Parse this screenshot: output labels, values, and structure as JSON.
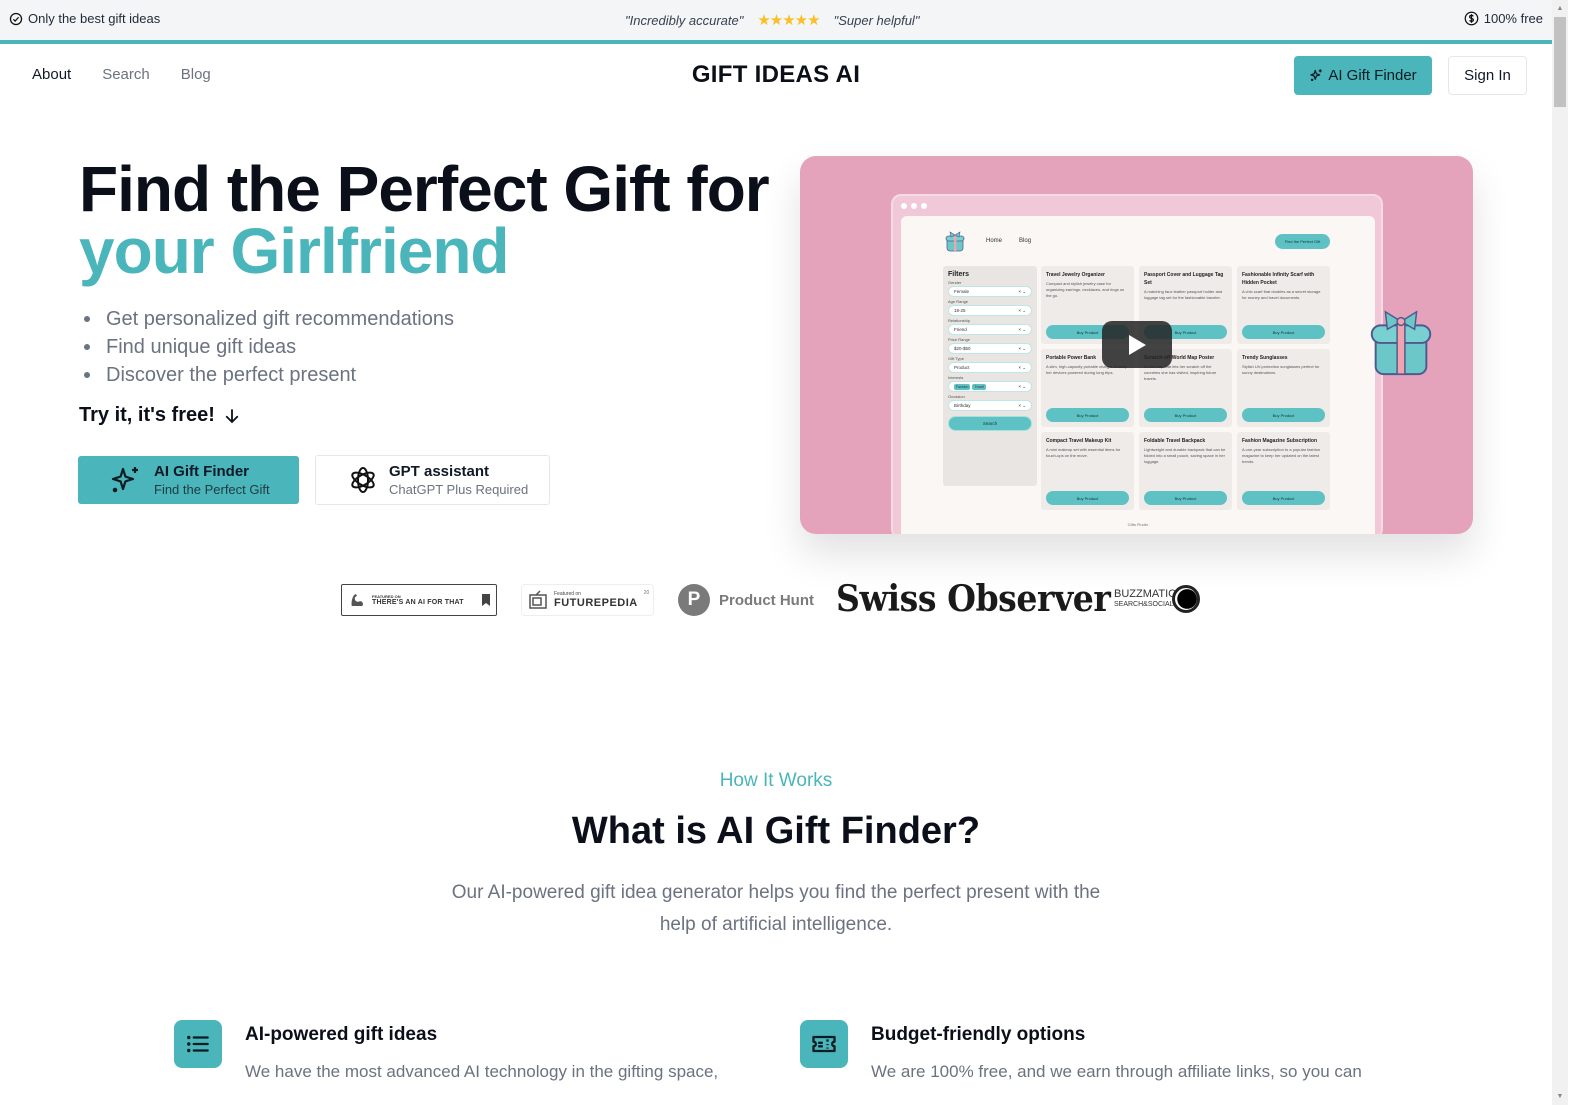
{
  "topbar": {
    "left_text": "Only the best gift ideas",
    "left_icon": "check-circle-icon",
    "quote_1": "\"Incredibly accurate\"",
    "rating_stars": 5,
    "stars_glyph": "★★★★★",
    "quote_2": "\"Super helpful\"",
    "right_text": "100% free",
    "right_icon": "dollar-circle-icon"
  },
  "header": {
    "nav": [
      {
        "label": "About",
        "active": true
      },
      {
        "label": "Search",
        "active": false
      },
      {
        "label": "Blog",
        "active": false
      }
    ],
    "brand": "GIFT IDEAS AI",
    "cta_label": "AI Gift Finder",
    "signin_label": "Sign In"
  },
  "hero": {
    "title_line1": "Find the Perfect Gift for",
    "title_line2": "your Girlfriend",
    "bullets": [
      "Get personalized gift recommendations",
      "Find unique gift ideas",
      "Discover the perfect present"
    ],
    "try_free": "Try it, it's free!",
    "cta_primary": {
      "title": "AI Gift Finder",
      "subtitle": "Find the Perfect Gift"
    },
    "cta_secondary": {
      "title": "GPT assistant",
      "subtitle": "ChatGPT Plus Required"
    }
  },
  "video_preview": {
    "nav": [
      "Home",
      "Blog"
    ],
    "top_button": "Find the Perfect Gift",
    "filters_title": "Filters",
    "filters": [
      {
        "label": "Gender",
        "value": "Female"
      },
      {
        "label": "Age Range",
        "value": "18-25"
      },
      {
        "label": "Relationship",
        "value": "Friend"
      },
      {
        "label": "Price Range",
        "value": "$20-$50"
      },
      {
        "label": "Gift Type",
        "value": "Product"
      },
      {
        "label": "Interests",
        "chips": [
          "Fashion",
          "Travel"
        ]
      },
      {
        "label": "Occasion",
        "value": "Birthday"
      }
    ],
    "search_button": "Search",
    "cards": [
      {
        "title": "Travel Jewelry Organizer",
        "desc": "Compact and stylish jewelry case for organizing earrings, necklaces, and rings on the go.",
        "button": "Buy Product"
      },
      {
        "title": "Passport Cover and Luggage Tag Set",
        "desc": "A matching faux leather passport holder and luggage tag set for the fashionable traveler.",
        "button": "Buy Product"
      },
      {
        "title": "Fashionable Infinity Scarf with Hidden Pocket",
        "desc": "A chic scarf that doubles as a secret storage for money and travel documents.",
        "button": "Buy Product"
      },
      {
        "title": "Portable Power Bank",
        "desc": "A slim, high-capacity portable charger to keep her devices powered during long trips.",
        "button": "Buy Product"
      },
      {
        "title": "Scratch-off World Map Poster",
        "desc": "A wall map that lets her scratch off the countries she has visited, inspiring future travels.",
        "button": "Buy Product"
      },
      {
        "title": "Trendy Sunglasses",
        "desc": "Stylish UV-protection sunglasses perfect for sunny destinations.",
        "button": "Buy Product"
      },
      {
        "title": "Compact Travel Makeup Kit",
        "desc": "A mini makeup set with essential items for touch-ups on the move.",
        "button": "Buy Product"
      },
      {
        "title": "Foldable Travel Backpack",
        "desc": "Lightweight and durable backpack that can be folded into a small pouch, saving space in her luggage.",
        "button": "Buy Product"
      },
      {
        "title": "Fashion Magazine Subscription",
        "desc": "A one-year subscription to a popular fashion magazine to keep her updated on the latest trends.",
        "button": "Buy Product"
      }
    ],
    "footer": "Gifts Finder",
    "play_icon": "play-icon"
  },
  "featured": {
    "taaft": {
      "line1": "FEATURED ON",
      "line2": "THERE'S AN AI FOR THAT"
    },
    "futurepedia": {
      "line1": "Featured on",
      "line2": "FUTUREPEDIA",
      "count": "20"
    },
    "producthunt": {
      "letter": "P",
      "name": "Product Hunt"
    },
    "swiss_observer": "Swiss Observer",
    "buzzmatic": {
      "line1": "BUZZMATIC",
      "line2": "SEARCH&SOCIAL"
    }
  },
  "how_it_works": {
    "eyebrow": "How It Works",
    "title": "What is AI Gift Finder?",
    "description": "Our AI-powered gift idea generator helps you find the perfect present with the help of artificial intelligence.",
    "features": [
      {
        "icon": "list-icon",
        "title": "AI-powered gift ideas",
        "desc": "We have the most advanced AI technology in the gifting space,"
      },
      {
        "icon": "ticket-icon",
        "title": "Budget-friendly options",
        "desc": "We are 100% free, and we earn through affiliate links, so you can"
      }
    ]
  },
  "colors": {
    "accent": "#4ab5ba",
    "video_bg": "#e4a3bb",
    "star": "#fbbf24"
  }
}
